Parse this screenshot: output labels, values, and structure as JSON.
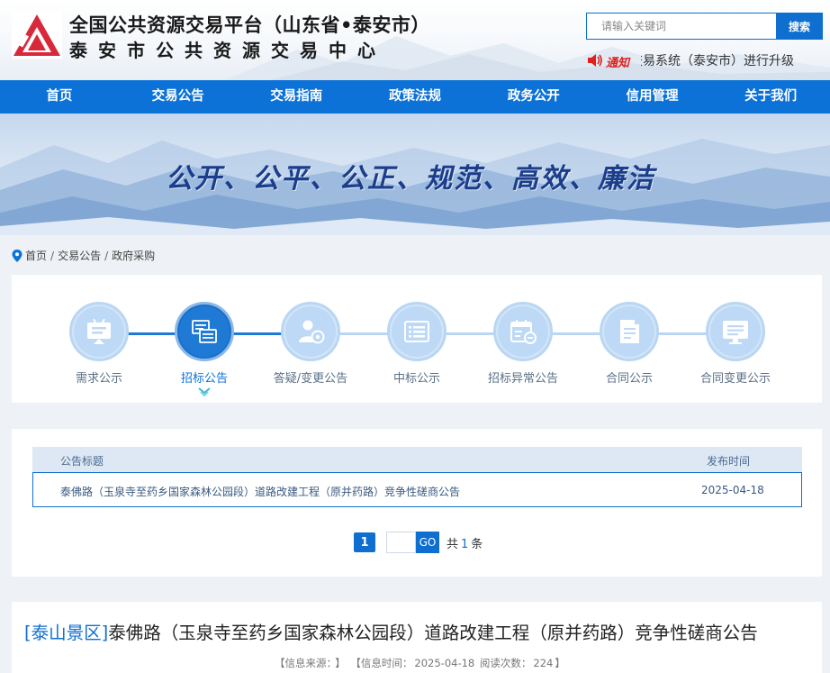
{
  "header": {
    "title_line1": "全国公共资源交易平台（山东省•泰安市）",
    "title_line2": "泰安市公共资源交易中心",
    "search_placeholder": "请输入关键词",
    "search_button": "搜索",
    "notice_label": "通知",
    "notice_text": "招标交易系统（泰安市）进行升级"
  },
  "nav": {
    "items": [
      "首页",
      "交易公告",
      "交易指南",
      "政策法规",
      "政务公开",
      "信用管理",
      "关于我们"
    ]
  },
  "banner": {
    "slogan": "公开、公平、公正、规范、高效、廉洁"
  },
  "breadcrumb": {
    "items": [
      "首页",
      "交易公告",
      "政府采购"
    ],
    "separator": "/"
  },
  "categories": {
    "items": [
      {
        "label": "需求公示",
        "icon": "monitor-icon",
        "active": false
      },
      {
        "label": "招标公告",
        "icon": "documents-icon",
        "active": true
      },
      {
        "label": "答疑/变更公告",
        "icon": "user-settings-icon",
        "active": false
      },
      {
        "label": "中标公示",
        "icon": "list-icon",
        "active": false
      },
      {
        "label": "招标异常公告",
        "icon": "calendar-minus-icon",
        "active": false
      },
      {
        "label": "合同公示",
        "icon": "contract-icon",
        "active": false
      },
      {
        "label": "合同变更公示",
        "icon": "screen-list-icon",
        "active": false
      }
    ]
  },
  "table": {
    "headers": {
      "title": "公告标题",
      "date": "发布时间"
    },
    "rows": [
      {
        "title": "泰佛路（玉泉寺至药乡国家森林公园段）道路改建工程（原并药路）竞争性磋商公告",
        "date": "2025-04-18"
      }
    ]
  },
  "pager": {
    "current_page": "1",
    "go_label": "GO",
    "total_prefix": "共",
    "total_count": "1",
    "total_suffix": "条"
  },
  "article": {
    "area": "[泰山景区]",
    "title": "泰佛路（玉泉寺至药乡国家森林公园段）道路改建工程（原并药路）竞争性磋商公告",
    "source_label": "【信息来源：",
    "source_value": "",
    "source_close": "】",
    "time_label": "【信息时间：",
    "time_value": "2025-04-18",
    "reads_label": "阅读次数：",
    "reads_value": "224",
    "reads_close": "】"
  },
  "colors": {
    "primary": "#0c72d8",
    "notice_red": "#e02020",
    "logo_red": "#d8283a"
  }
}
